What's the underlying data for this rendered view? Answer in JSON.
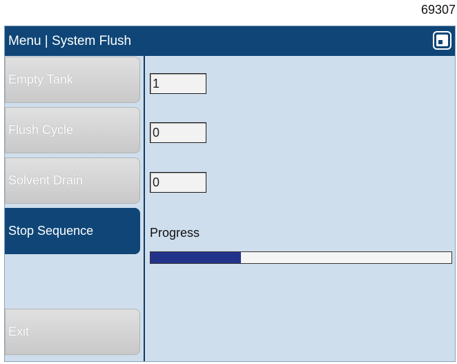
{
  "figure_id": "69307",
  "window": {
    "title": "Menu | System Flush"
  },
  "sidebar": {
    "items": [
      {
        "label": "Empty Tank",
        "state": "disabled"
      },
      {
        "label": "Flush Cycle",
        "state": "disabled"
      },
      {
        "label": "Solvent Drain",
        "state": "disabled"
      },
      {
        "label": "Stop Sequence",
        "state": "active"
      },
      {
        "label": "Exit",
        "state": "disabled"
      }
    ]
  },
  "fields": {
    "empty_tank": "1",
    "flush_cycle": "0",
    "solvent_drain": "0"
  },
  "progress": {
    "label": "Progress",
    "fraction": 0.3
  },
  "colors": {
    "titlebar": "#0f4677",
    "background": "#cfdeed",
    "progress_fill": "#24338a"
  },
  "icons": {
    "title_button": "window-control-icon"
  }
}
